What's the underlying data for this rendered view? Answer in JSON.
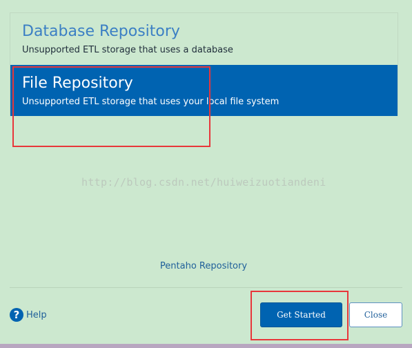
{
  "repositories": [
    {
      "title": "Database Repository",
      "description": "Unsupported ETL storage that uses a database",
      "selected": false
    },
    {
      "title": "File Repository",
      "description": "Unsupported ETL storage that uses your local file system",
      "selected": true
    }
  ],
  "watermark": "http://blog.csdn.net/huiweizuotiandeni",
  "pentaho_link": "Pentaho Repository",
  "footer": {
    "help_label": "Help",
    "get_started_label": "Get Started",
    "close_label": "Close"
  },
  "colors": {
    "accent": "#0063b1",
    "background": "#cce8cf",
    "annotation": "#e8363a"
  }
}
